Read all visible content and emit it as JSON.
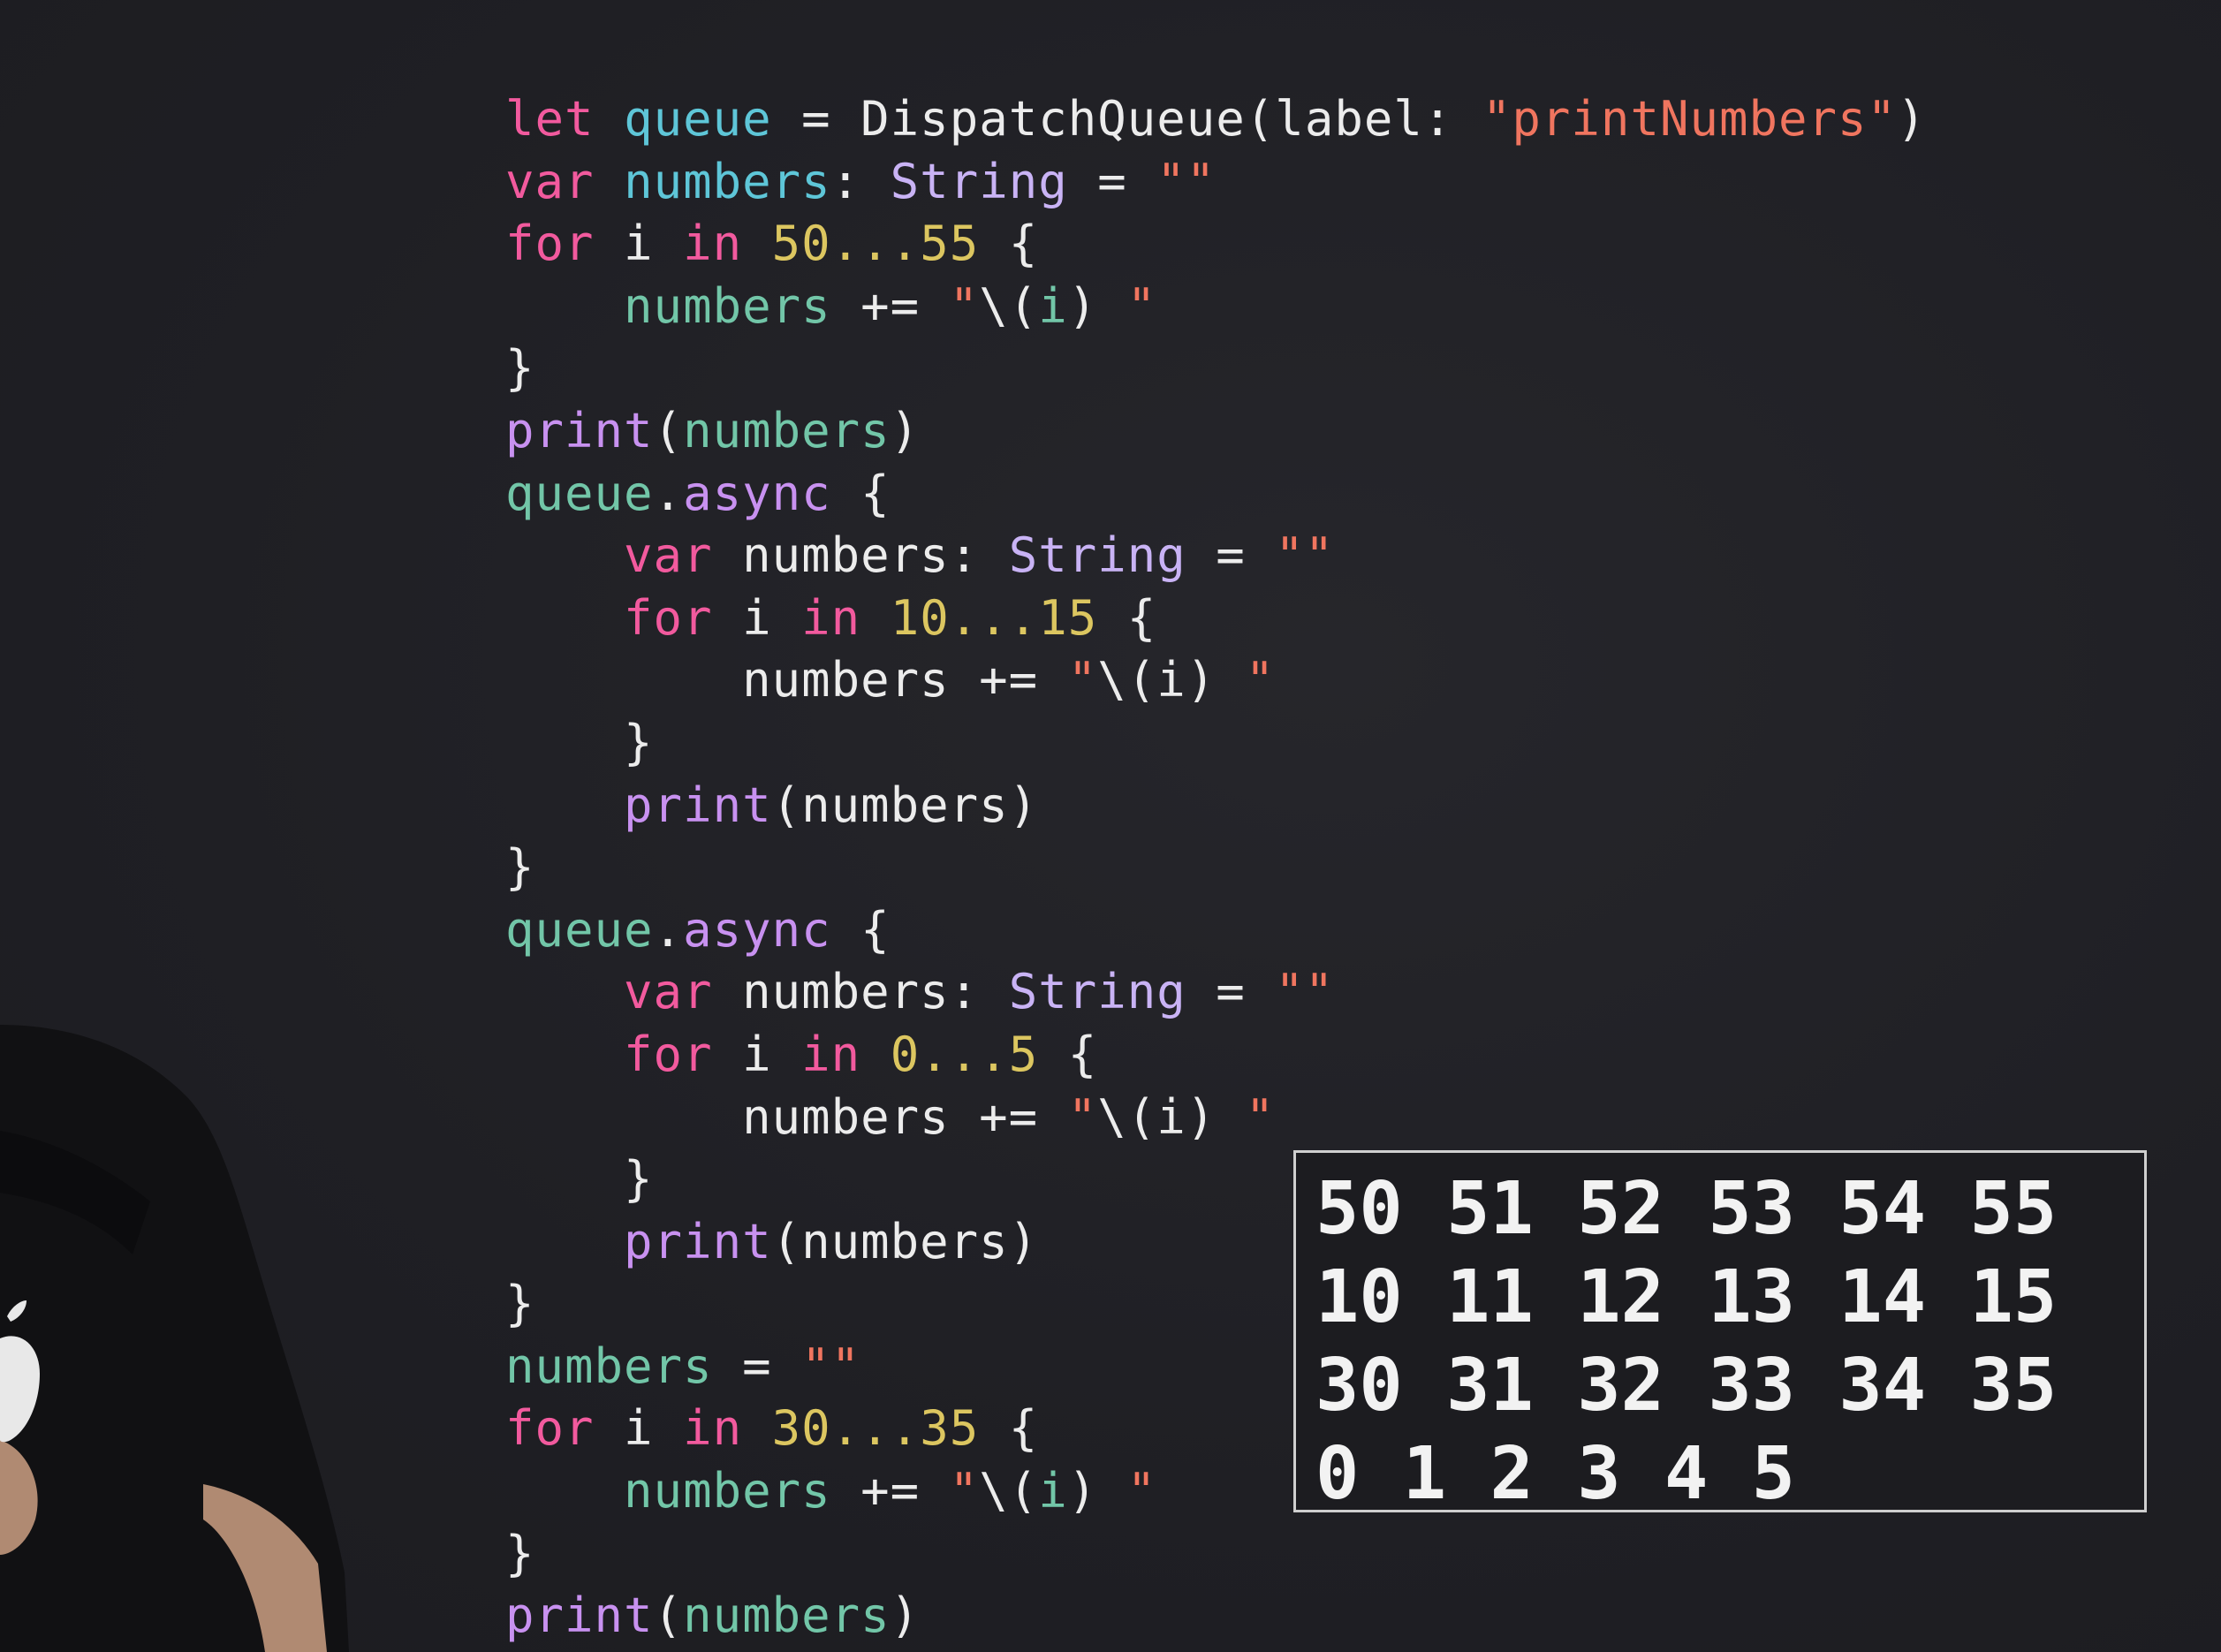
{
  "code_lines": [
    [
      [
        "kw",
        "let"
      ],
      [
        "plain",
        " "
      ],
      [
        "id",
        "queue"
      ],
      [
        "plain",
        " = DispatchQueue(label: "
      ],
      [
        "str",
        "\"printNumbers\""
      ],
      [
        "plain",
        ")"
      ]
    ],
    [
      [
        "kw",
        "var"
      ],
      [
        "plain",
        " "
      ],
      [
        "id",
        "numbers"
      ],
      [
        "plain",
        ": "
      ],
      [
        "ty",
        "String"
      ],
      [
        "plain",
        " = "
      ],
      [
        "str",
        "\"\""
      ]
    ],
    [
      [
        "kw",
        "for"
      ],
      [
        "plain",
        " i "
      ],
      [
        "kw",
        "in"
      ],
      [
        "plain",
        " "
      ],
      [
        "num",
        "50...55"
      ],
      [
        "plain",
        " {"
      ]
    ],
    [
      [
        "plain",
        "    "
      ],
      [
        "mem",
        "numbers"
      ],
      [
        "plain",
        " += "
      ],
      [
        "str",
        "\""
      ],
      [
        "plain",
        "\\("
      ],
      [
        "mem",
        "i"
      ],
      [
        "plain",
        ") "
      ],
      [
        "str",
        "\""
      ]
    ],
    [
      [
        "plain",
        "}"
      ]
    ],
    [
      [
        "fn",
        "print"
      ],
      [
        "plain",
        "("
      ],
      [
        "mem",
        "numbers"
      ],
      [
        "plain",
        ")"
      ]
    ],
    [
      [
        "mem",
        "queue"
      ],
      [
        "plain",
        "."
      ],
      [
        "fn",
        "async"
      ],
      [
        "plain",
        " {"
      ]
    ],
    [
      [
        "plain",
        "    "
      ],
      [
        "kw",
        "var"
      ],
      [
        "plain",
        " numbers: "
      ],
      [
        "ty",
        "String"
      ],
      [
        "plain",
        " = "
      ],
      [
        "str",
        "\"\""
      ]
    ],
    [
      [
        "plain",
        "    "
      ],
      [
        "kw",
        "for"
      ],
      [
        "plain",
        " i "
      ],
      [
        "kw",
        "in"
      ],
      [
        "plain",
        " "
      ],
      [
        "num",
        "10...15"
      ],
      [
        "plain",
        " {"
      ]
    ],
    [
      [
        "plain",
        "        numbers += "
      ],
      [
        "str",
        "\""
      ],
      [
        "plain",
        "\\(i) "
      ],
      [
        "str",
        "\""
      ]
    ],
    [
      [
        "plain",
        "    }"
      ]
    ],
    [
      [
        "plain",
        "    "
      ],
      [
        "fn",
        "print"
      ],
      [
        "plain",
        "(numbers)"
      ]
    ],
    [
      [
        "plain",
        "}"
      ]
    ],
    [
      [
        "mem",
        "queue"
      ],
      [
        "plain",
        "."
      ],
      [
        "fn",
        "async"
      ],
      [
        "plain",
        " {"
      ]
    ],
    [
      [
        "plain",
        "    "
      ],
      [
        "kw",
        "var"
      ],
      [
        "plain",
        " numbers: "
      ],
      [
        "ty",
        "String"
      ],
      [
        "plain",
        " = "
      ],
      [
        "str",
        "\"\""
      ]
    ],
    [
      [
        "plain",
        "    "
      ],
      [
        "kw",
        "for"
      ],
      [
        "plain",
        " i "
      ],
      [
        "kw",
        "in"
      ],
      [
        "plain",
        " "
      ],
      [
        "num",
        "0...5"
      ],
      [
        "plain",
        " {"
      ]
    ],
    [
      [
        "plain",
        "        numbers += "
      ],
      [
        "str",
        "\""
      ],
      [
        "plain",
        "\\(i) "
      ],
      [
        "str",
        "\""
      ]
    ],
    [
      [
        "plain",
        "    }"
      ]
    ],
    [
      [
        "plain",
        "    "
      ],
      [
        "fn",
        "print"
      ],
      [
        "plain",
        "(numbers)"
      ]
    ],
    [
      [
        "plain",
        "}"
      ]
    ],
    [
      [
        "mem",
        "numbers"
      ],
      [
        "plain",
        " = "
      ],
      [
        "str",
        "\"\""
      ]
    ],
    [
      [
        "kw",
        "for"
      ],
      [
        "plain",
        " i "
      ],
      [
        "kw",
        "in"
      ],
      [
        "plain",
        " "
      ],
      [
        "num",
        "30...35"
      ],
      [
        "plain",
        " {"
      ]
    ],
    [
      [
        "plain",
        "    "
      ],
      [
        "mem",
        "numbers"
      ],
      [
        "plain",
        " += "
      ],
      [
        "str",
        "\""
      ],
      [
        "plain",
        "\\("
      ],
      [
        "mem",
        "i"
      ],
      [
        "plain",
        ") "
      ],
      [
        "str",
        "\""
      ]
    ],
    [
      [
        "plain",
        "}"
      ]
    ],
    [
      [
        "fn",
        "print"
      ],
      [
        "plain",
        "("
      ],
      [
        "mem",
        "numbers"
      ],
      [
        "plain",
        ")"
      ]
    ]
  ],
  "output": {
    "lines": [
      "50 51 52 53 54 55",
      "10 11 12 13 14 15",
      "30 31 32 33 34 35",
      "0 1 2 3 4 5"
    ]
  },
  "colors": {
    "background": "#1f1f24",
    "keyword": "#f25a9e",
    "function": "#c891f0",
    "type": "#c9b3f5",
    "number": "#dcc660",
    "string": "#f0755f",
    "identifier": "#5ec6d8",
    "member": "#72c6a8",
    "text": "#ececec",
    "output_border": "#cfcfcf"
  }
}
